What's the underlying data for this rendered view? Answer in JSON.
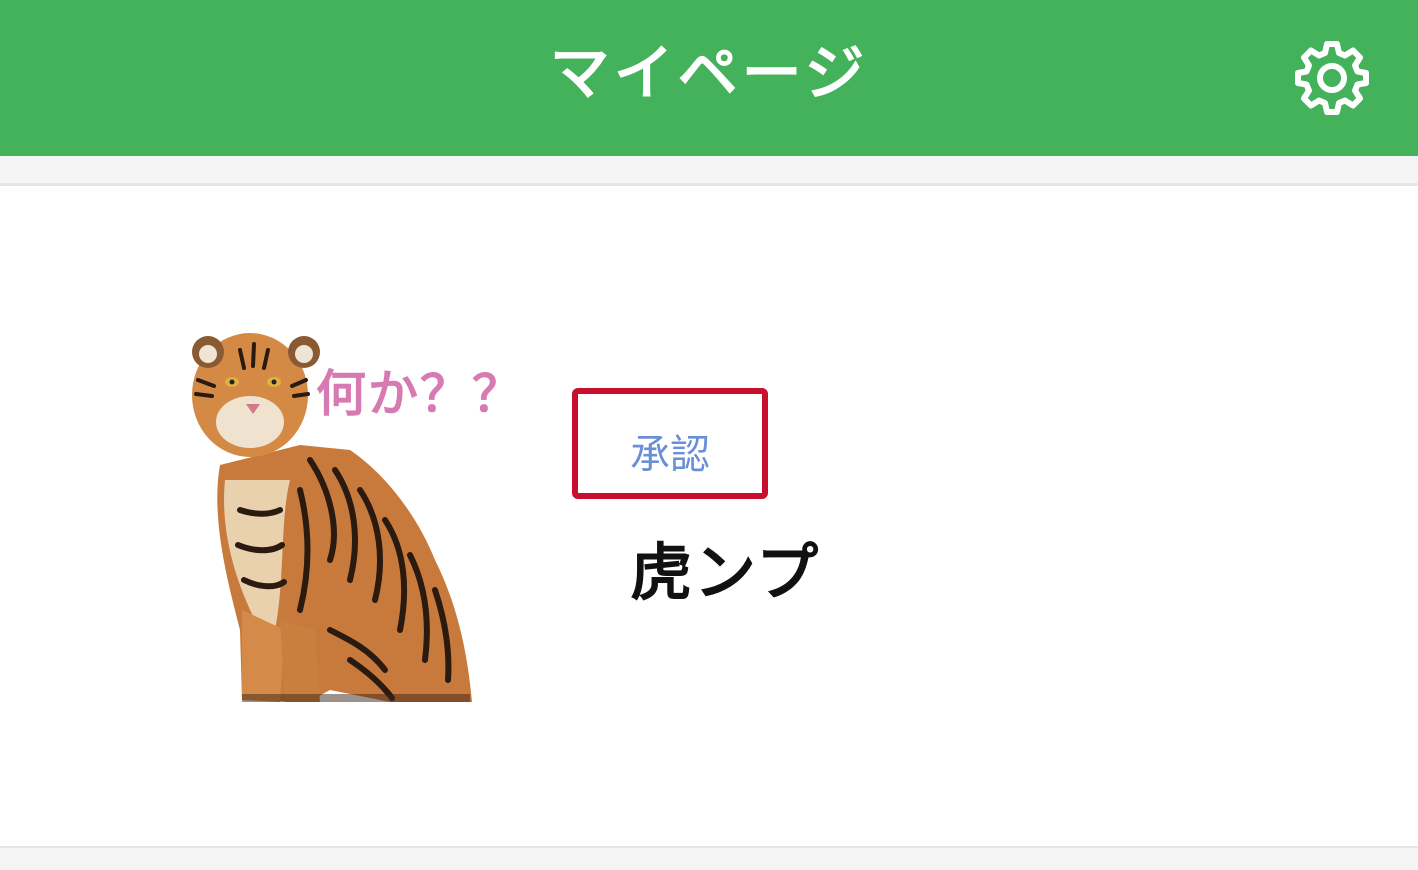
{
  "header": {
    "title": "マイページ",
    "settings_icon": "gear-icon",
    "background_color": "#43b25a"
  },
  "profile": {
    "avatar_caption": "何か？？",
    "approve_button_label": "承認",
    "approve_button_border_color": "#c8102e",
    "user_name": "虎ンプ"
  }
}
